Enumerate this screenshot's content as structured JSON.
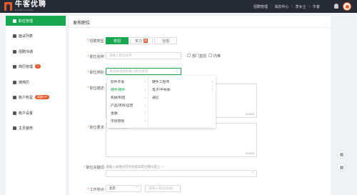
{
  "header": {
    "logo_text": "牛客优聘",
    "logo_sub": "NOWCOURE",
    "links": [
      "招聘管理",
      "消息中心",
      "李女士",
      "牛客"
    ]
  },
  "sidebar": {
    "items": [
      {
        "label": "职位管理",
        "active": true
      },
      {
        "label": "面试列表"
      },
      {
        "label": "招聘沟通"
      },
      {
        "label": "简历管理",
        "badge": "1"
      },
      {
        "label": "搜简历"
      },
      {
        "label": "账户权益",
        "badge": "高级VIP"
      },
      {
        "label": "账户设置"
      },
      {
        "label": "主页装修"
      }
    ]
  },
  "form": {
    "title": "发布职位",
    "recruit_type": {
      "label": "招聘类型:",
      "options": [
        "校招",
        "实习",
        "社招"
      ],
      "hot": "热",
      "selected": "校招"
    },
    "job_name": {
      "label": "职位名称:",
      "placeholder": "请输入职位名称"
    },
    "dept_checkbox": "部门直招",
    "internal_checkbox": "内推",
    "job_category": {
      "label": "职位类别:",
      "placeholder": "请选择或搜索输入职位类别"
    },
    "job_desc": {
      "label": "职位描述:",
      "placeholder": "请输入职位描述",
      "count": "0/2000"
    },
    "job_req": {
      "label": "职位要求:",
      "placeholder": "请输入职位要求",
      "count": "0/2000"
    },
    "keywords": {
      "label": "职位关键词:",
      "hint": "请输入关键词可有效提高职位曝光度之一"
    },
    "work_location": {
      "label": "工作地点:",
      "city": "北京",
      "placeholder": "请输入地址(选填)"
    }
  },
  "cascader": {
    "level1": [
      "软件开发",
      "硬件/硬件",
      "机械/制造",
      "产品/项目/运营",
      "金融",
      "市场营销"
    ],
    "level1_selected": "硬件/硬件",
    "level2": [
      "硬件工程师",
      "电子/半导体",
      "通信"
    ]
  }
}
